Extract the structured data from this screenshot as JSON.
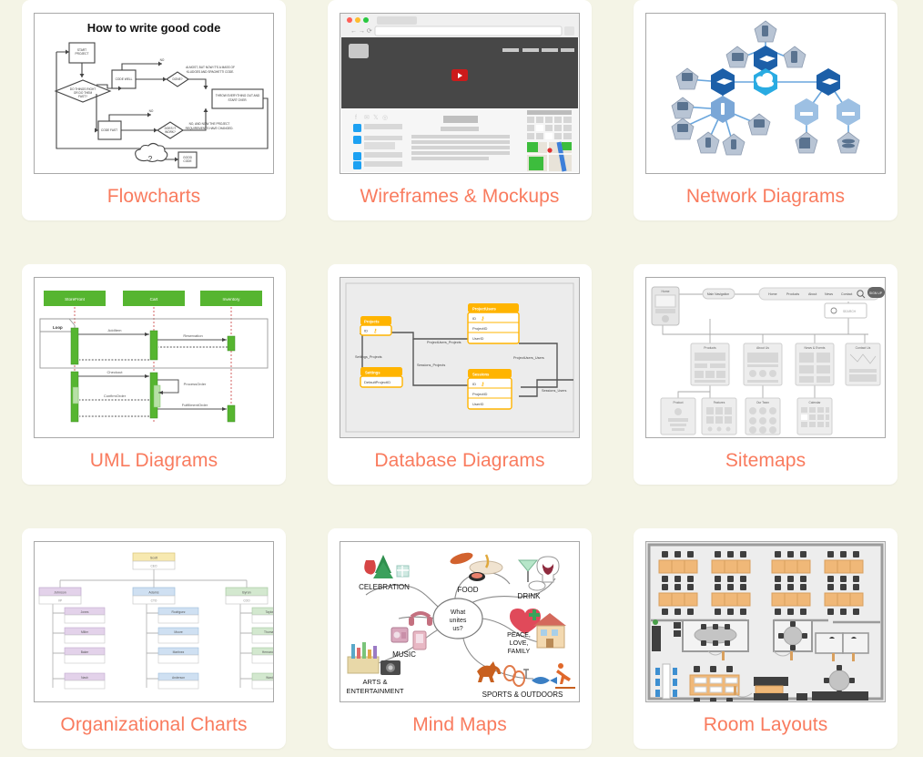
{
  "page": {
    "background_color": "#f4f4e6",
    "card_background": "#ffffff",
    "label_color": "#f97b5e"
  },
  "cards": [
    {
      "id": "flowcharts",
      "label": "Flowcharts",
      "thumbnail": {
        "kind": "flowchart",
        "title": "How to write good code",
        "nodes": [
          "START PROJECT",
          "DO THINGS RIGHT OR DO THEM FAST?",
          "CODE WELL",
          "DONE?",
          "CODE FAST",
          "DOES IT WORK?",
          "THROW EVERYTHING OUT AND START OVER.",
          "GOOD CODE",
          "?"
        ],
        "edge_labels": [
          "NO",
          "NO",
          "ALMOST, BUT NOW IT'S A MASS OF KLUDGES AND SPAGHETTI CODE.",
          "NO, AND NOW THE PROJECT REQUIREMENTS HAVE CHANGED."
        ]
      }
    },
    {
      "id": "wireframes-mockups",
      "label": "Wireframes & Mockups",
      "thumbnail": {
        "kind": "wireframe",
        "browser_dots": [
          "#ff5f57",
          "#febc2e",
          "#28c840"
        ],
        "hero_color": "#474747",
        "play_button_color": "#cc1b1b",
        "social_icon_color": "#1da1f2",
        "nav_item_count": 4,
        "map_colors": {
          "land": "#e8e3d9",
          "park": "#3dbd3d",
          "water": "#3d7fd9",
          "pin": "#e03030"
        }
      }
    },
    {
      "id": "network-diagrams",
      "label": "Network Diagrams",
      "thumbnail": {
        "kind": "network",
        "colors": {
          "cloud": "#29abe2",
          "router": "#1c5fa8",
          "switch": "#7ba7d7",
          "device": "#b8c4d4",
          "link": "#6aa6dd"
        },
        "node_types": [
          "cloud",
          "router",
          "switch",
          "server",
          "printer",
          "pc",
          "phone",
          "tablet",
          "database",
          "document"
        ]
      }
    },
    {
      "id": "uml-diagrams",
      "label": "UML Diagrams",
      "thumbnail": {
        "kind": "uml-sequence",
        "actors": [
          "StoreFront",
          "Cart",
          "Inventory"
        ],
        "frame_label": "Loop",
        "messages": [
          "AddItem",
          "Reservation",
          "Checkout",
          "ProcessOrder",
          "ConfirmOrder",
          "FulfillmentOrder"
        ],
        "actor_color": "#56b530"
      }
    },
    {
      "id": "database-diagrams",
      "label": "Database Diagrams",
      "thumbnail": {
        "kind": "database",
        "tables": [
          {
            "name": "Projects",
            "fields": [
              "ID"
            ]
          },
          {
            "name": "ProjectUsers",
            "fields": [
              "ID",
              "ProjectID",
              "UserID"
            ]
          },
          {
            "name": "Settings",
            "fields": [
              "DefaultProjectID"
            ]
          },
          {
            "name": "Sessions",
            "fields": [
              "ID",
              "ProjectID",
              "UserID"
            ]
          }
        ],
        "relationships": [
          "Settings_Projects",
          "ProjectUsers_Projects",
          "Sessions_Projects",
          "ProjectUsers_Users",
          "Sessions_Users"
        ],
        "table_header_color": "#ffb400"
      }
    },
    {
      "id": "sitemaps",
      "label": "Sitemaps",
      "thumbnail": {
        "kind": "sitemap",
        "root": "Home",
        "nav_label": "Main Navigation",
        "nav_items": [
          "Home",
          "Products",
          "About",
          "News",
          "Contact"
        ],
        "cta_label": "SIGN UP",
        "search_label": "SEARCH",
        "pages": [
          "Products",
          "About Us",
          "News & Events",
          "Contact Us"
        ],
        "subpages": [
          "Product",
          "Features",
          "Our Team",
          "Calendar"
        ]
      }
    },
    {
      "id": "organizational-charts",
      "label": "Organizational Charts",
      "thumbnail": {
        "kind": "orgchart",
        "root": {
          "name": "Scott",
          "title": "CEO",
          "color": "#f7e9b0"
        },
        "branches": [
          {
            "name": "Johnson",
            "title": "VP",
            "color": "#e3d2ea",
            "children": [
              "Jones",
              "Miller",
              "Baker",
              "Nash"
            ]
          },
          {
            "name": "Adams",
            "title": "CTO",
            "color": "#cfe0f2",
            "children": [
              "Rodriguez",
              "Moore",
              "Martinez",
              "Anderson"
            ]
          },
          {
            "name": "Byron",
            "title": "COO",
            "color": "#d3e8cf",
            "children": [
              "Taylor",
              "Thomas",
              "Hernandez",
              "Ward"
            ]
          }
        ]
      }
    },
    {
      "id": "mind-maps",
      "label": "Mind Maps",
      "thumbnail": {
        "kind": "mindmap",
        "center": "What unites us?",
        "branches": [
          "CELEBRATION",
          "FOOD",
          "DRINK",
          "PEACE, LOVE, FAMILY",
          "SPORTS & OUTDOORS",
          "ARTS & ENTERTAINMENT",
          "MUSIC"
        ]
      }
    },
    {
      "id": "room-layouts",
      "label": "Room Layouts",
      "thumbnail": {
        "kind": "roomlayout",
        "colors": {
          "desk": "#f0b878",
          "chair": "#4a4a4a",
          "floor": "#ececec",
          "wall": "#9b9b9b",
          "accent": "#3d8fd1"
        },
        "desk_clusters": 8,
        "meeting_rooms": 2
      }
    }
  ]
}
